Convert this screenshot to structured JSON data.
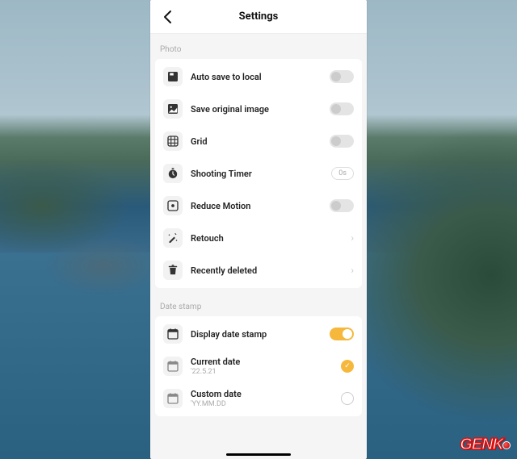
{
  "header": {
    "title": "Settings"
  },
  "sections": {
    "photo": {
      "label": "Photo",
      "auto_save": "Auto save to local",
      "save_original": "Save original image",
      "grid": "Grid",
      "shooting_timer": "Shooting Timer",
      "shooting_timer_value": "0s",
      "reduce_motion": "Reduce Motion",
      "retouch": "Retouch",
      "recently_deleted": "Recently deleted"
    },
    "date_stamp": {
      "label": "Date stamp",
      "display": "Display date stamp",
      "current": "Current date",
      "current_sub": "'22.5.21",
      "custom": "Custom date",
      "custom_sub": "'YY.MM.DD"
    }
  },
  "watermark": "GENK"
}
